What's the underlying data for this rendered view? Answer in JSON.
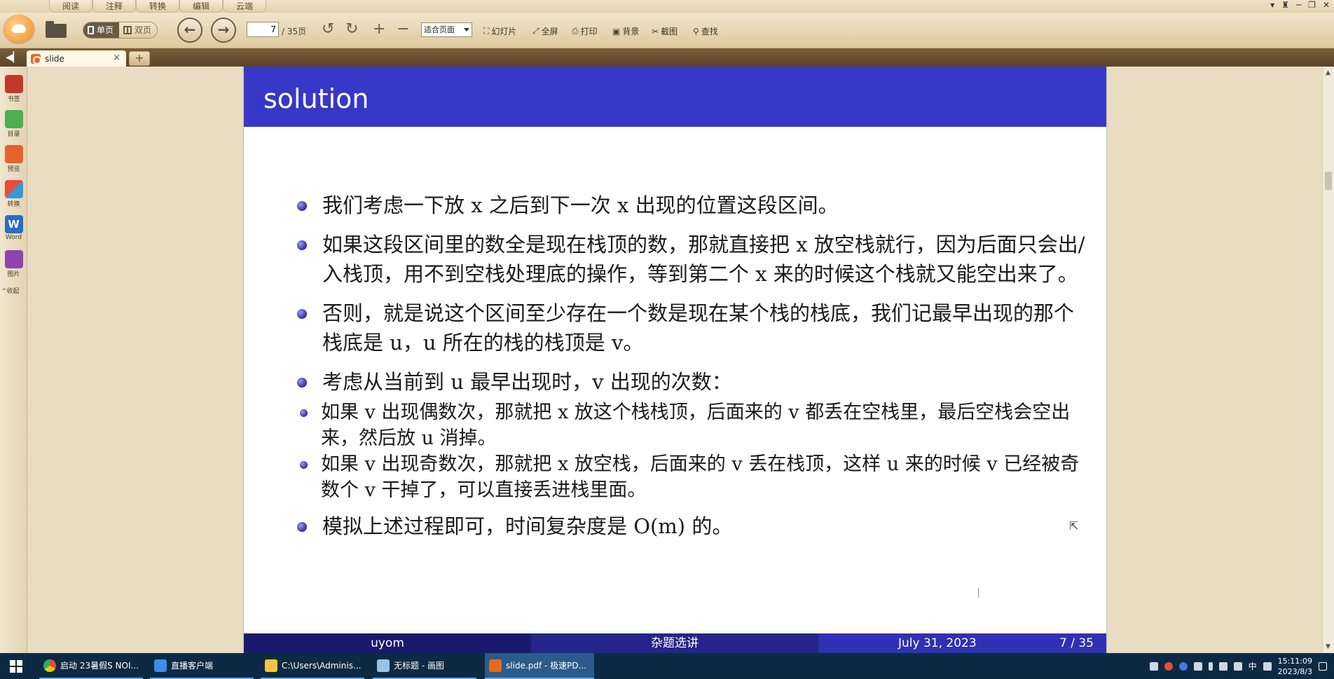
{
  "menu": {
    "tabs": [
      "阅读",
      "注释",
      "转换",
      "编辑",
      "云端"
    ]
  },
  "toolbar": {
    "single_page": "单页",
    "double_page": "双页",
    "page_current": "7",
    "page_total": "/ 35页",
    "zoom": "适合页面",
    "tools": [
      "幻灯片",
      "全屏",
      "打印",
      "背景",
      "截图",
      "查找"
    ]
  },
  "tabbar": {
    "doc_tab": "slide",
    "close": "×",
    "add": "+"
  },
  "sidebar": {
    "items": [
      "书签",
      "目录",
      "预览",
      "转换",
      "Word",
      "图片"
    ],
    "collapse": "^收起"
  },
  "slide": {
    "title": "solution",
    "bullets": [
      "我们考虑一下放 x 之后到下一次 x 出现的位置这段区间。",
      "如果这段区间里的数全是现在栈顶的数，那就直接把 x 放空栈就行，因为后面只会出/入栈顶，用不到空栈处理底的操作，等到第二个 x 来的时候这个栈就又能空出来了。",
      "否则，就是说这个区间至少存在一个数是现在某个栈的栈底，我们记最早出现的那个栈底是 u，u 所在的栈的栈顶是 v。",
      "考虑从当前到 u 最早出现时，v 出现的次数："
    ],
    "sub_bullets": [
      "如果 v 出现偶数次，那就把 x 放这个栈栈顶，后面来的 v 都丢在空栈里，最后空栈会空出来，然后放 u 消掉。",
      "如果 v 出现奇数次，那就把 x 放空栈，后面来的 v 丢在栈顶，这样 u 来的时候 v 已经被奇数个 v 干掉了，可以直接丢进栈里面。"
    ],
    "last_bullet": "模拟上述过程即可，时间复杂度是 O(m) 的。",
    "footer": {
      "author": "uyom",
      "topic": "杂题选讲",
      "date": "July 31, 2023",
      "page": "7 / 35"
    }
  },
  "taskbar": {
    "apps": [
      "启动 23暑假S NOI...",
      "直播客户端",
      "C:\\Users\\Adminis...",
      "无标题 - 画图",
      "slide.pdf - 极速PD..."
    ],
    "ime": "中",
    "time": "15:11:09",
    "date": "2023/8/3"
  },
  "colors": {
    "slide_header": "#3737c8",
    "footer_dark": "#1a1a6c",
    "footer_mid": "#24248a",
    "footer_light": "#3030b4",
    "taskbar": "#0d2a44"
  }
}
